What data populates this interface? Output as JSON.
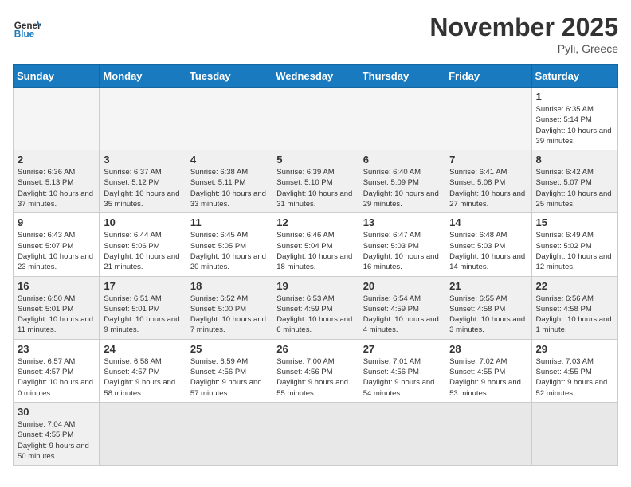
{
  "header": {
    "logo_general": "General",
    "logo_blue": "Blue",
    "month_title": "November 2025",
    "location": "Pyli, Greece"
  },
  "weekdays": [
    "Sunday",
    "Monday",
    "Tuesday",
    "Wednesday",
    "Thursday",
    "Friday",
    "Saturday"
  ],
  "days": [
    {
      "date": "",
      "info": ""
    },
    {
      "date": "",
      "info": ""
    },
    {
      "date": "",
      "info": ""
    },
    {
      "date": "",
      "info": ""
    },
    {
      "date": "",
      "info": ""
    },
    {
      "date": "",
      "info": ""
    },
    {
      "date": "1",
      "info": "Sunrise: 6:35 AM\nSunset: 5:14 PM\nDaylight: 10 hours and 39 minutes."
    },
    {
      "date": "2",
      "info": "Sunrise: 6:36 AM\nSunset: 5:13 PM\nDaylight: 10 hours and 37 minutes."
    },
    {
      "date": "3",
      "info": "Sunrise: 6:37 AM\nSunset: 5:12 PM\nDaylight: 10 hours and 35 minutes."
    },
    {
      "date": "4",
      "info": "Sunrise: 6:38 AM\nSunset: 5:11 PM\nDaylight: 10 hours and 33 minutes."
    },
    {
      "date": "5",
      "info": "Sunrise: 6:39 AM\nSunset: 5:10 PM\nDaylight: 10 hours and 31 minutes."
    },
    {
      "date": "6",
      "info": "Sunrise: 6:40 AM\nSunset: 5:09 PM\nDaylight: 10 hours and 29 minutes."
    },
    {
      "date": "7",
      "info": "Sunrise: 6:41 AM\nSunset: 5:08 PM\nDaylight: 10 hours and 27 minutes."
    },
    {
      "date": "8",
      "info": "Sunrise: 6:42 AM\nSunset: 5:07 PM\nDaylight: 10 hours and 25 minutes."
    },
    {
      "date": "9",
      "info": "Sunrise: 6:43 AM\nSunset: 5:07 PM\nDaylight: 10 hours and 23 minutes."
    },
    {
      "date": "10",
      "info": "Sunrise: 6:44 AM\nSunset: 5:06 PM\nDaylight: 10 hours and 21 minutes."
    },
    {
      "date": "11",
      "info": "Sunrise: 6:45 AM\nSunset: 5:05 PM\nDaylight: 10 hours and 20 minutes."
    },
    {
      "date": "12",
      "info": "Sunrise: 6:46 AM\nSunset: 5:04 PM\nDaylight: 10 hours and 18 minutes."
    },
    {
      "date": "13",
      "info": "Sunrise: 6:47 AM\nSunset: 5:03 PM\nDaylight: 10 hours and 16 minutes."
    },
    {
      "date": "14",
      "info": "Sunrise: 6:48 AM\nSunset: 5:03 PM\nDaylight: 10 hours and 14 minutes."
    },
    {
      "date": "15",
      "info": "Sunrise: 6:49 AM\nSunset: 5:02 PM\nDaylight: 10 hours and 12 minutes."
    },
    {
      "date": "16",
      "info": "Sunrise: 6:50 AM\nSunset: 5:01 PM\nDaylight: 10 hours and 11 minutes."
    },
    {
      "date": "17",
      "info": "Sunrise: 6:51 AM\nSunset: 5:01 PM\nDaylight: 10 hours and 9 minutes."
    },
    {
      "date": "18",
      "info": "Sunrise: 6:52 AM\nSunset: 5:00 PM\nDaylight: 10 hours and 7 minutes."
    },
    {
      "date": "19",
      "info": "Sunrise: 6:53 AM\nSunset: 4:59 PM\nDaylight: 10 hours and 6 minutes."
    },
    {
      "date": "20",
      "info": "Sunrise: 6:54 AM\nSunset: 4:59 PM\nDaylight: 10 hours and 4 minutes."
    },
    {
      "date": "21",
      "info": "Sunrise: 6:55 AM\nSunset: 4:58 PM\nDaylight: 10 hours and 3 minutes."
    },
    {
      "date": "22",
      "info": "Sunrise: 6:56 AM\nSunset: 4:58 PM\nDaylight: 10 hours and 1 minute."
    },
    {
      "date": "23",
      "info": "Sunrise: 6:57 AM\nSunset: 4:57 PM\nDaylight: 10 hours and 0 minutes."
    },
    {
      "date": "24",
      "info": "Sunrise: 6:58 AM\nSunset: 4:57 PM\nDaylight: 9 hours and 58 minutes."
    },
    {
      "date": "25",
      "info": "Sunrise: 6:59 AM\nSunset: 4:56 PM\nDaylight: 9 hours and 57 minutes."
    },
    {
      "date": "26",
      "info": "Sunrise: 7:00 AM\nSunset: 4:56 PM\nDaylight: 9 hours and 55 minutes."
    },
    {
      "date": "27",
      "info": "Sunrise: 7:01 AM\nSunset: 4:56 PM\nDaylight: 9 hours and 54 minutes."
    },
    {
      "date": "28",
      "info": "Sunrise: 7:02 AM\nSunset: 4:55 PM\nDaylight: 9 hours and 53 minutes."
    },
    {
      "date": "29",
      "info": "Sunrise: 7:03 AM\nSunset: 4:55 PM\nDaylight: 9 hours and 52 minutes."
    },
    {
      "date": "30",
      "info": "Sunrise: 7:04 AM\nSunset: 4:55 PM\nDaylight: 9 hours and 50 minutes."
    },
    {
      "date": "",
      "info": ""
    },
    {
      "date": "",
      "info": ""
    },
    {
      "date": "",
      "info": ""
    },
    {
      "date": "",
      "info": ""
    },
    {
      "date": "",
      "info": ""
    },
    {
      "date": "",
      "info": ""
    }
  ]
}
